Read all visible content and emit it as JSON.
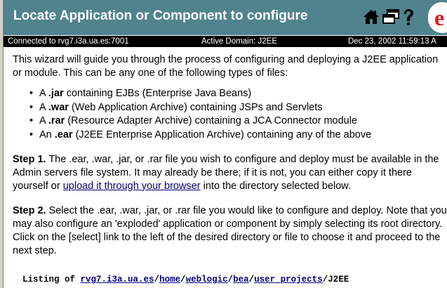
{
  "header": {
    "title": "Locate Application or Component to configure",
    "icons": [
      "home-icon",
      "windows-icon",
      "help-icon"
    ],
    "logo": "bea-logo",
    "colors": {
      "title_bg": "#50838e",
      "status_bg": "#000000",
      "link": "#00007f"
    }
  },
  "status": {
    "connected": "Connected to rvg7.i3a.ua.es:7001",
    "domain": "Active Domain: J2EE",
    "timestamp": "Dec 23, 2002 11:59:13 A"
  },
  "intro": "This wizard will guide you through the process of configuring and deploying a J2EE application or module. This can be any one of the following types of files:",
  "file_types": [
    {
      "article": "A ",
      "ext": ".jar",
      "desc": " containing EJBs (Enterprise Java Beans)"
    },
    {
      "article": "A ",
      "ext": ".war",
      "desc": " (Web Application Archive) containing JSPs and Servlets"
    },
    {
      "article": "A ",
      "ext": ".rar",
      "desc": " (Resource Adapter Archive) containing a JCA Connector module"
    },
    {
      "article": "An ",
      "ext": ".ear",
      "desc": " (J2EE Enterprise Application Archive) containing any of the above"
    }
  ],
  "step1": {
    "label": "Step 1.",
    "text_before": " The .ear, .war, .jar, or .rar file you wish to configure and deploy must be available in the Admin servers file system. It may already be there; if it is not, you can either copy it there yourself or ",
    "link": "upload it through your browser",
    "text_after": " into the directory selected below."
  },
  "step2": {
    "label": "Step 2.",
    "text": " Select the .ear, .war, .jar, or .rar file you would like to configure and deploy. Note that you may also configure an 'exploded' application or component by simply selecting its root directory. Click on the [select] link to the left of the desired directory or file to choose it and proceed to the next step."
  },
  "listing": {
    "label": "Listing of",
    "path": [
      "rvg7.i3a.ua.es",
      "home",
      "weblogic",
      "bea",
      "user_projects"
    ],
    "separator": "/",
    "current": "J2EE"
  }
}
